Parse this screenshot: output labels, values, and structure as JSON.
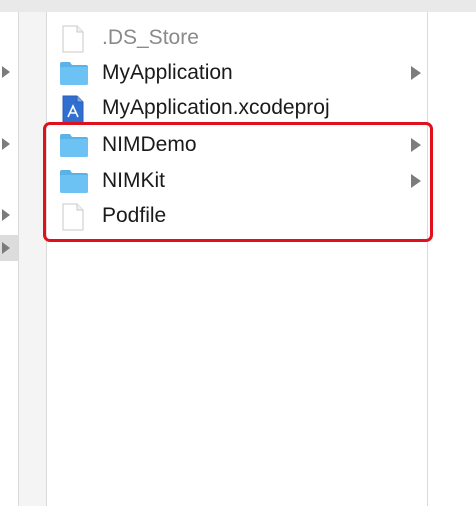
{
  "files": [
    {
      "name": ".DS_Store",
      "kind": "document",
      "hidden": true,
      "has_children": false
    },
    {
      "name": "MyApplication",
      "kind": "folder",
      "hidden": false,
      "has_children": true
    },
    {
      "name": "MyApplication.xcodeproj",
      "kind": "xcodeproj",
      "hidden": false,
      "has_children": false
    },
    {
      "name": "NIMDemo",
      "kind": "folder",
      "hidden": false,
      "has_children": true
    },
    {
      "name": "NIMKit",
      "kind": "folder",
      "hidden": false,
      "has_children": true
    },
    {
      "name": "Podfile",
      "kind": "document",
      "hidden": false,
      "has_children": false
    }
  ],
  "highlight": {
    "color": "#e0101d",
    "covers": [
      "NIMDemo",
      "NIMKit",
      "Podfile"
    ]
  },
  "colors": {
    "folder": "#6cc2f3",
    "folder_tab": "#5ab3e8",
    "disclosure": "#7d7d7d"
  }
}
